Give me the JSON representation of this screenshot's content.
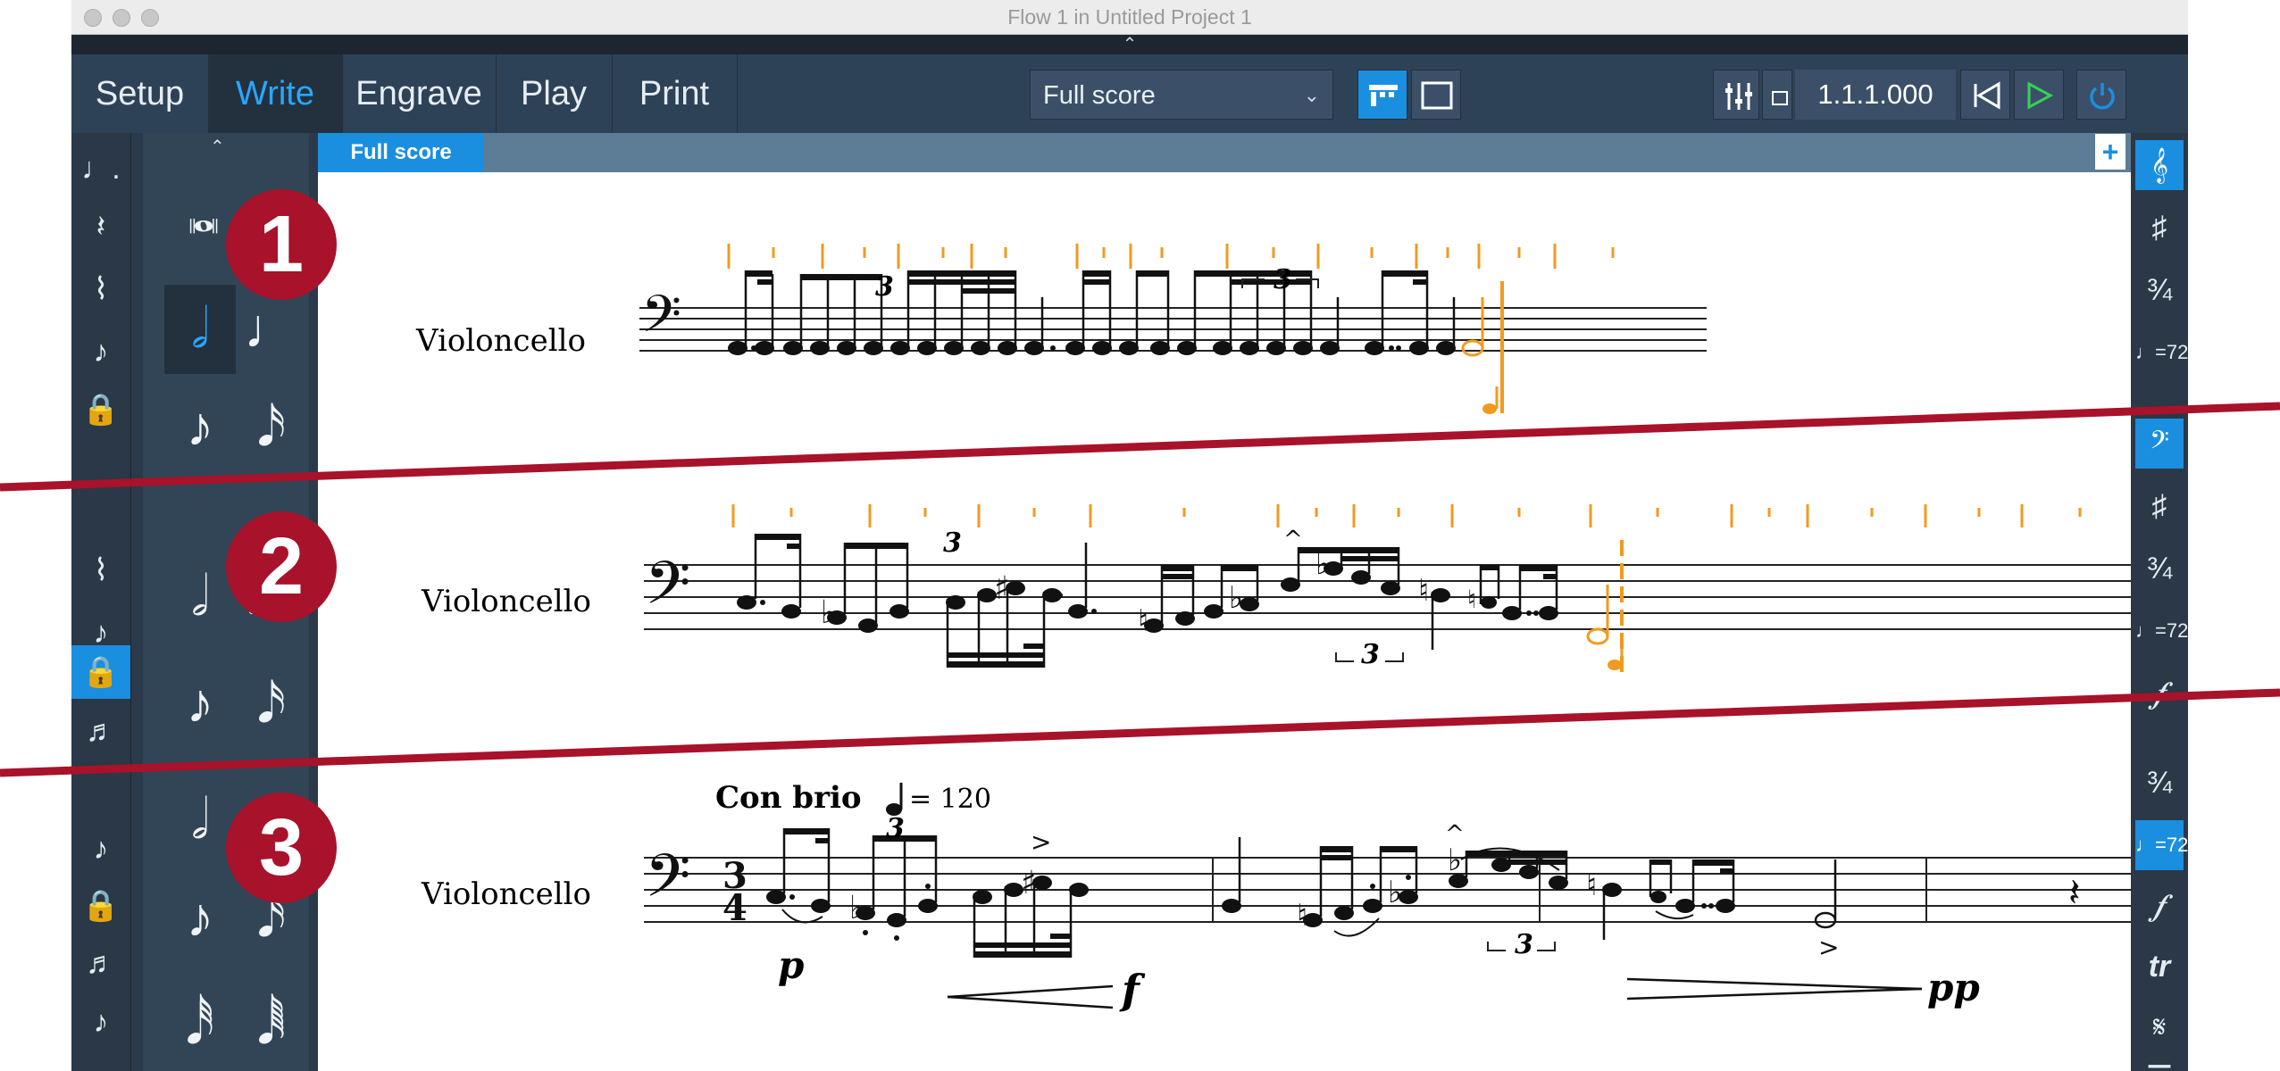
{
  "window": {
    "title": "Flow 1 in Untitled Project 1",
    "collapse_glyph": "⌃"
  },
  "toolbar": {
    "modes": [
      "Setup",
      "Write",
      "Engrave",
      "Play",
      "Print"
    ],
    "active_mode": "Write",
    "layout_select": "Full score",
    "layout_chevron": "⌄",
    "position": "1.1.1.000"
  },
  "score_tab": {
    "label": "Full score",
    "add": "+"
  },
  "instrument": "Violoncello",
  "tempo": {
    "text": "Con brio",
    "equals": "= 120"
  },
  "tuplet": "3",
  "dynamics": {
    "p": "p",
    "f": "f",
    "pp": "pp"
  },
  "badges": [
    "1",
    "2",
    "3"
  ],
  "up_chevron": "⌃",
  "colors": {
    "accent": "#1a8fe0",
    "input_caret": "#f29a1f",
    "divider": "#a8122a"
  }
}
